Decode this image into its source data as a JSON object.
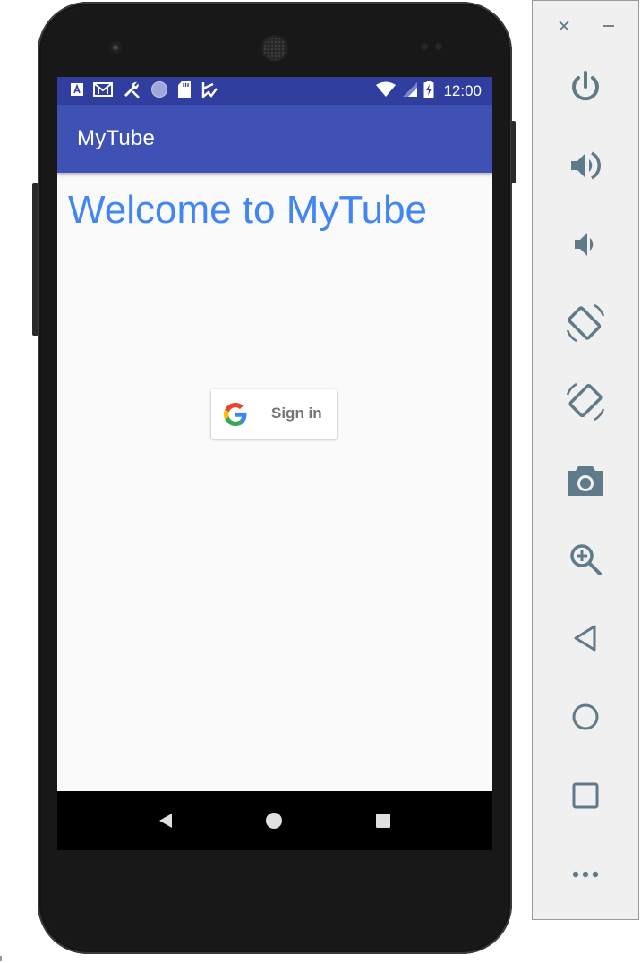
{
  "app": {
    "title": "MyTube",
    "welcome_text": "Welcome to MyTube",
    "signin_label": "Sign in"
  },
  "status_bar": {
    "time": "12:00",
    "notification_icons": [
      "a-icon",
      "gmail-icon",
      "wrench-icon",
      "circle-icon",
      "sd-card-icon",
      "checklist-icon"
    ],
    "system_icons": [
      "wifi-icon",
      "signal-icon",
      "battery-charging-icon"
    ]
  },
  "nav_bar": {
    "buttons": [
      "back",
      "home",
      "recents"
    ]
  },
  "emulator_panel": {
    "window_controls": [
      "close",
      "minimize"
    ],
    "tools": [
      "power",
      "volume-up",
      "volume-down",
      "rotate-left",
      "rotate-right",
      "screenshot",
      "zoom",
      "back",
      "home",
      "overview",
      "more"
    ]
  },
  "colors": {
    "status_bar": "#303f9f",
    "app_bar": "#3f51b5",
    "welcome_text": "#4285f4",
    "screen_bg": "#fafafa",
    "panel_icon": "#5f7a89"
  }
}
